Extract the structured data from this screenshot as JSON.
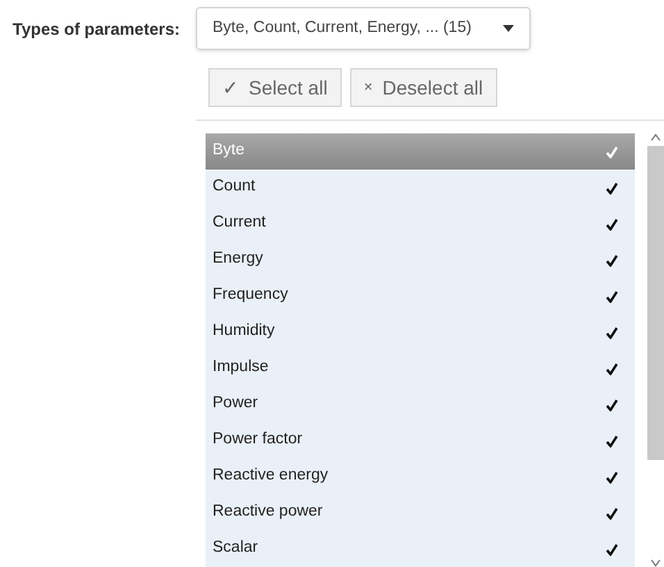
{
  "filter": {
    "label": "Types of parameters:",
    "value": "Byte,  Count,  Current,  Energy, ... (15)"
  },
  "buttons": [
    {
      "icon": "✓",
      "label": "Select all"
    },
    {
      "icon": "×",
      "label": "Deselect all"
    }
  ],
  "items": [
    {
      "label": "Byte",
      "selected": true,
      "checked": true
    },
    {
      "label": "Count",
      "selected": false,
      "checked": true
    },
    {
      "label": "Current",
      "selected": false,
      "checked": true
    },
    {
      "label": "Energy",
      "selected": false,
      "checked": true
    },
    {
      "label": "Frequency",
      "selected": false,
      "checked": true
    },
    {
      "label": "Humidity",
      "selected": false,
      "checked": true
    },
    {
      "label": "Impulse",
      "selected": false,
      "checked": true
    },
    {
      "label": "Power",
      "selected": false,
      "checked": true
    },
    {
      "label": "Power factor",
      "selected": false,
      "checked": true
    },
    {
      "label": "Reactive energy",
      "selected": false,
      "checked": true
    },
    {
      "label": "Reactive power",
      "selected": false,
      "checked": true
    },
    {
      "label": "Scalar",
      "selected": false,
      "checked": true
    }
  ]
}
